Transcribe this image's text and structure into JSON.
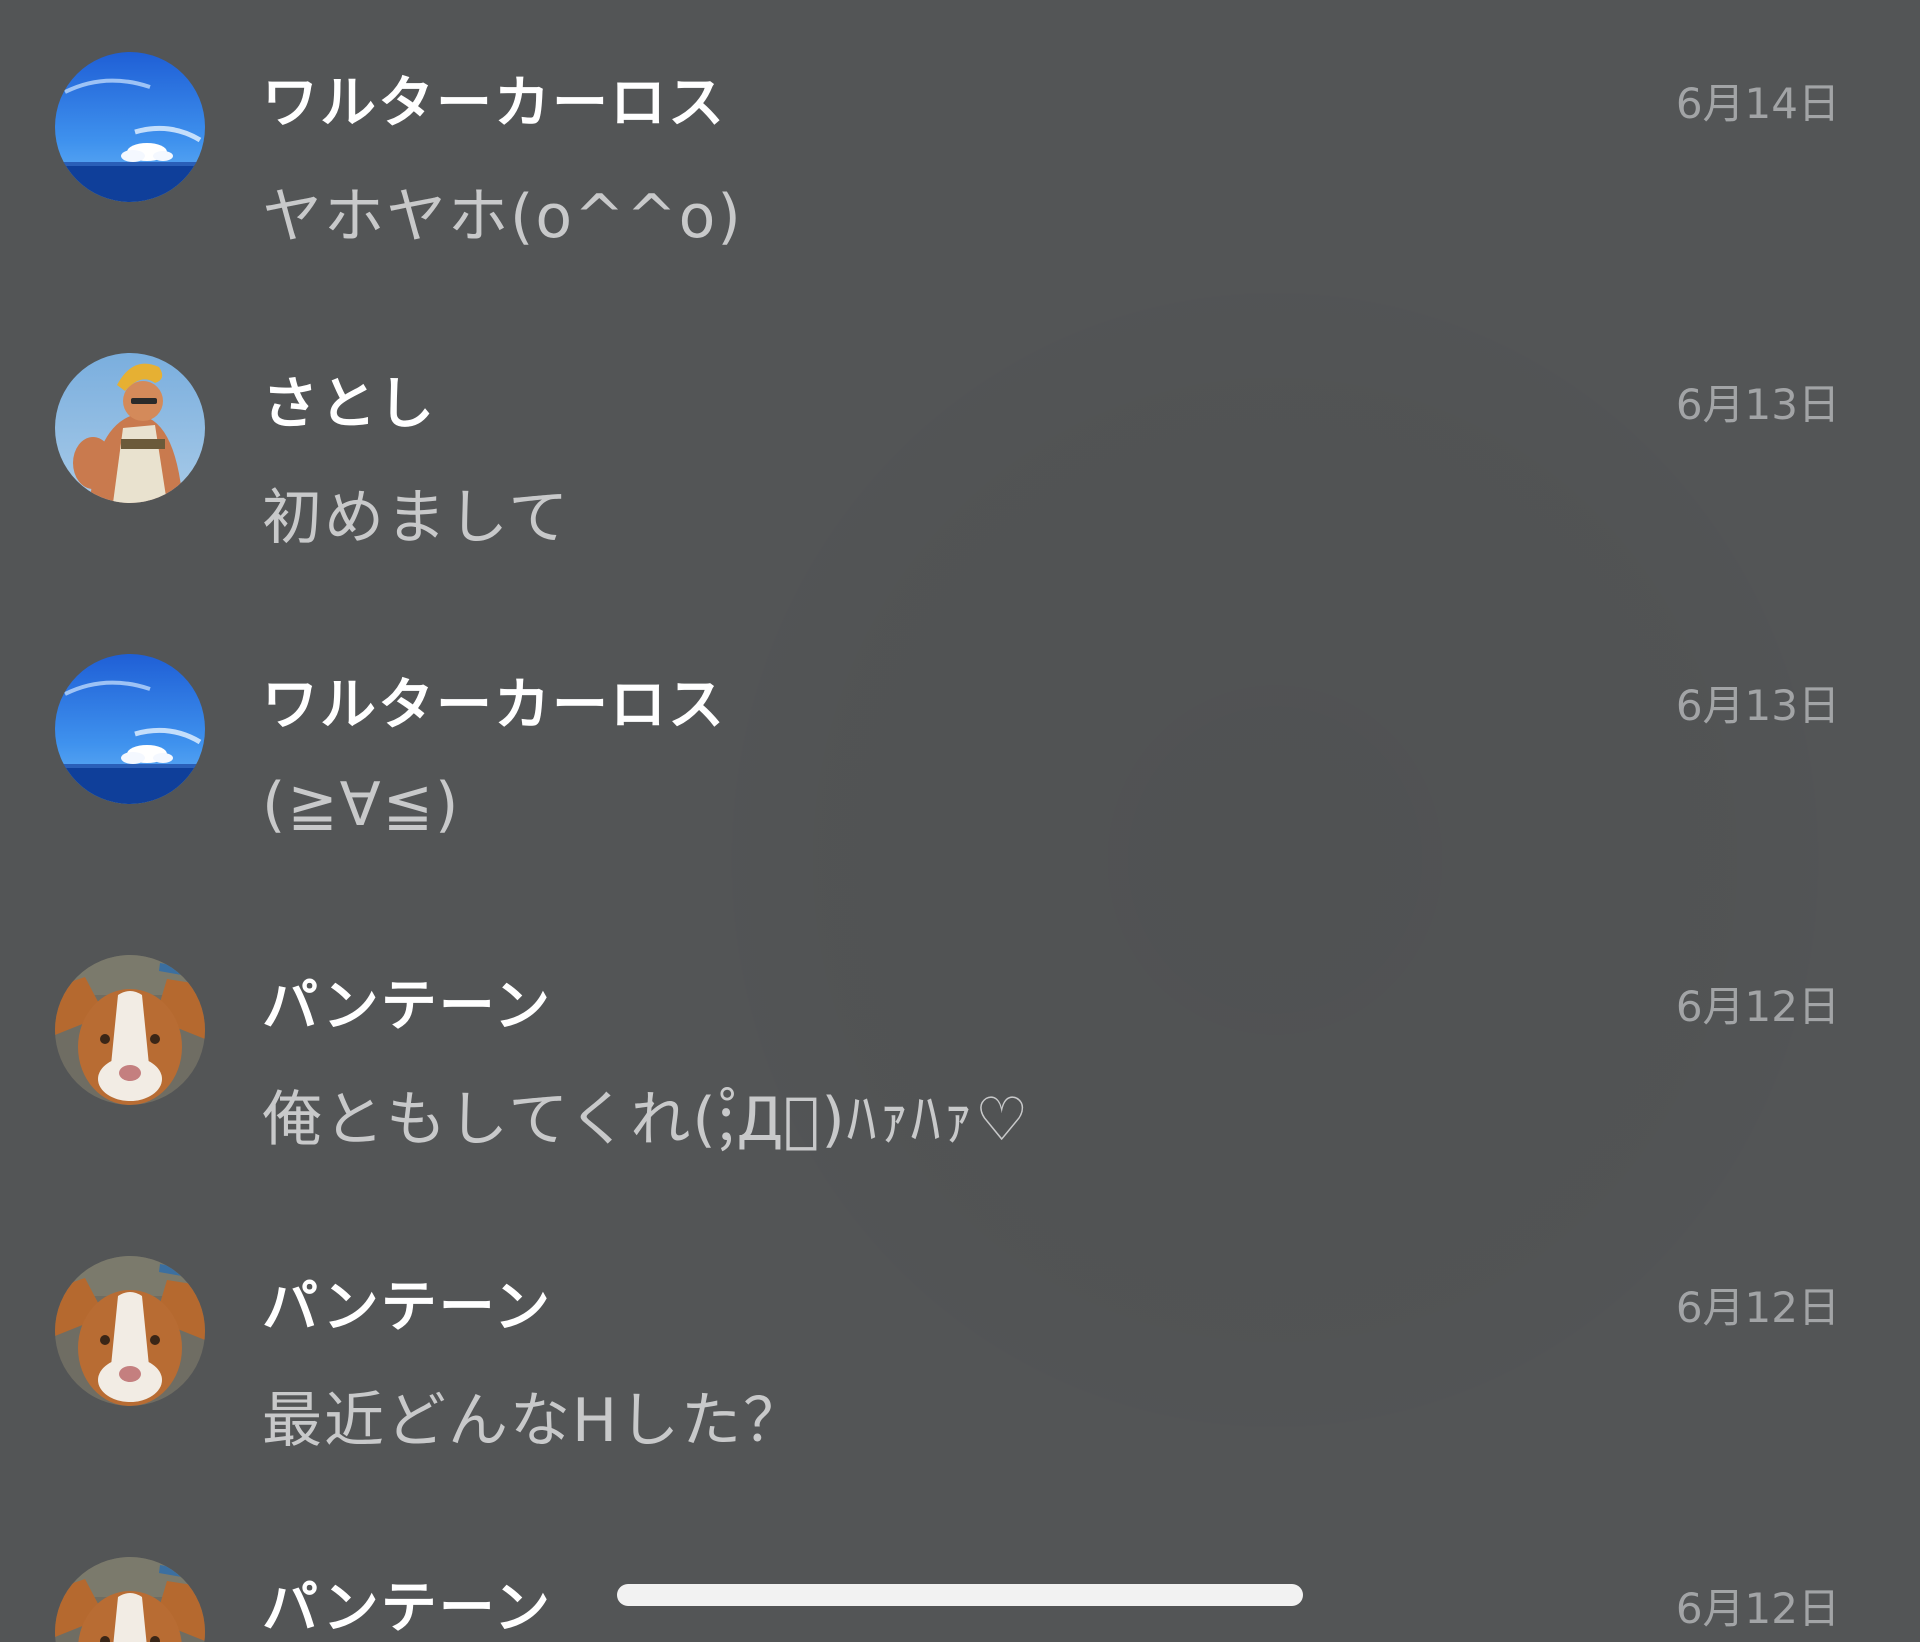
{
  "messages": [
    {
      "sender": "ワルターカーロス",
      "preview": "ヤホヤホ(o^^o)",
      "date": "6月14日",
      "avatar": "sky-icon"
    },
    {
      "sender": "さとし",
      "preview": "初めまして",
      "date": "6月13日",
      "avatar": "muscle-man-icon"
    },
    {
      "sender": "ワルターカーロス",
      "preview": "(≧∀≦)",
      "date": "6月13日",
      "avatar": "sky-icon"
    },
    {
      "sender": "パンテーン",
      "preview": "俺ともしてくれ(;゚Д゚)ﾊｧﾊｧ♡",
      "date": "6月12日",
      "avatar": "dog-icon"
    },
    {
      "sender": "パンテーン",
      "preview": "最近どんなHした？",
      "date": "6月12日",
      "avatar": "dog-icon"
    },
    {
      "sender": "パンテーン",
      "preview": "",
      "date": "6月12日",
      "avatar": "dog-icon"
    }
  ],
  "colors": {
    "background": "#535556",
    "sender_text": "#ffffff",
    "preview_text": "#c8c9ca",
    "date_text": "#a2a4a6",
    "home_indicator": "#f2f2f2"
  }
}
